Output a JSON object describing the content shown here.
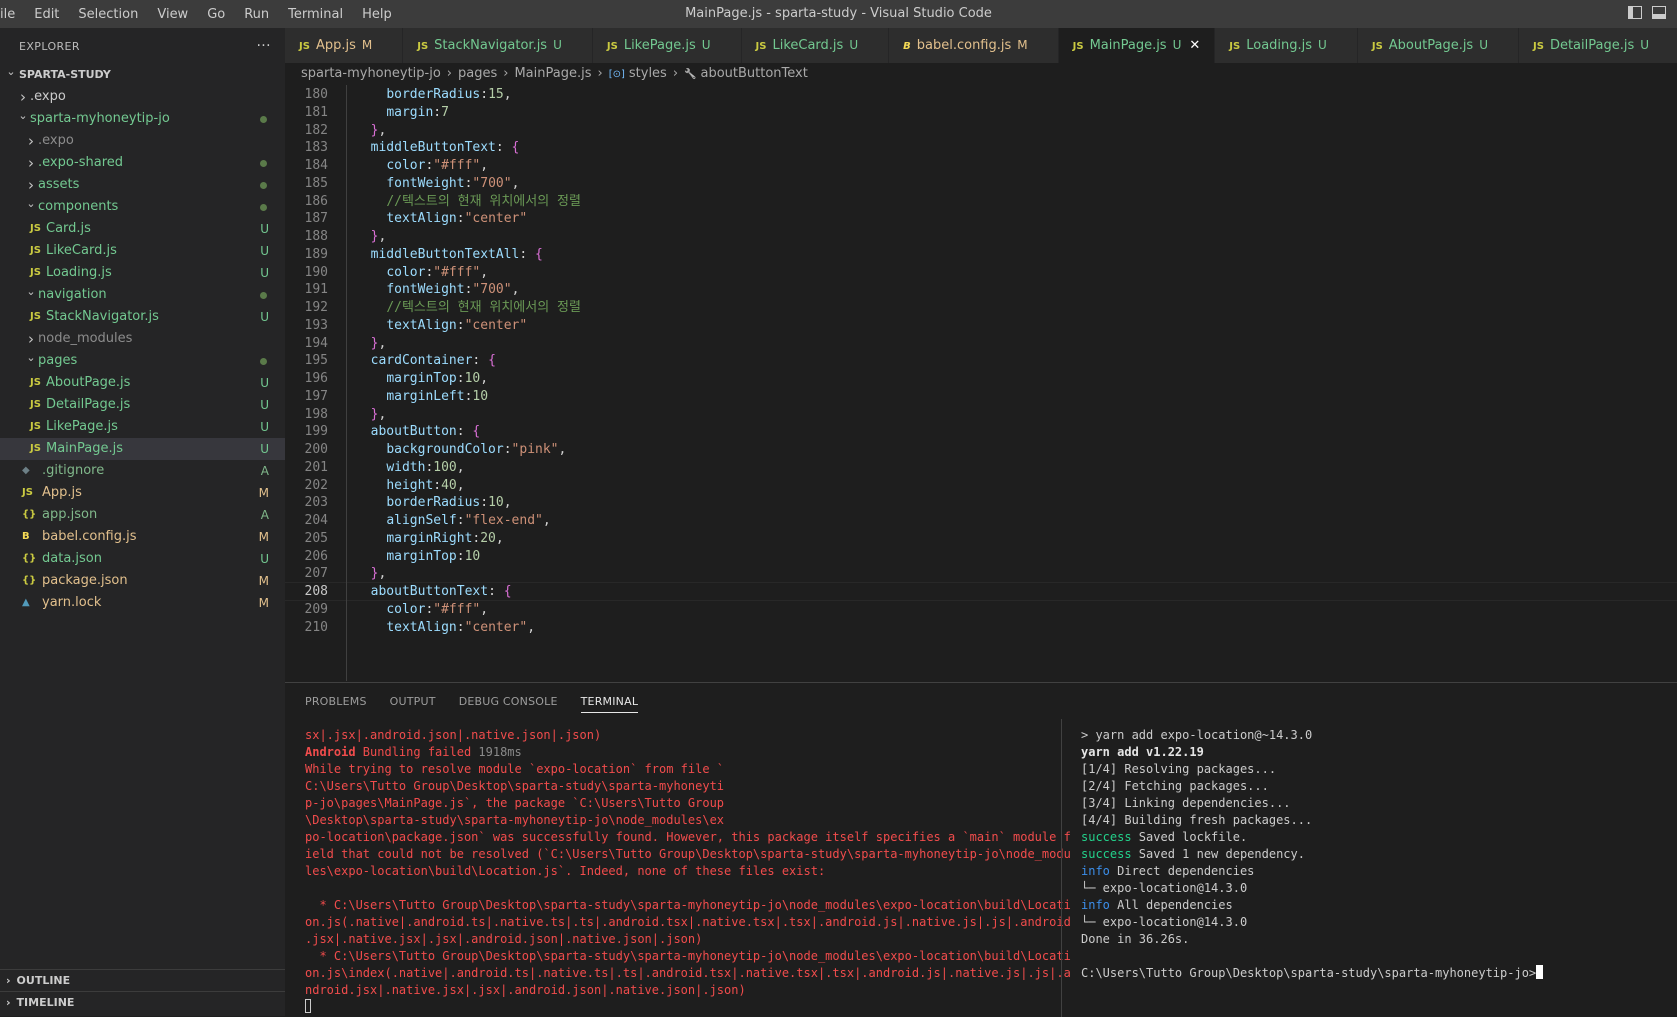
{
  "menu": [
    "ile",
    "Edit",
    "Selection",
    "View",
    "Go",
    "Run",
    "Terminal",
    "Help"
  ],
  "window_title": "MainPage.js - sparta-study - Visual Studio Code",
  "sidebar": {
    "header": "EXPLORER",
    "more": "···",
    "outline": "OUTLINE",
    "timeline": "TIMELINE",
    "tree": [
      {
        "label": "SPARTA-STUDY",
        "depth": 0,
        "kind": "root",
        "open": true
      },
      {
        "label": ".expo",
        "depth": 1,
        "kind": "folder",
        "open": false,
        "color": "#cccccc"
      },
      {
        "label": "sparta-myhoneytip-jo",
        "depth": 1,
        "kind": "folder",
        "open": true,
        "color": "#73c991",
        "dot": true
      },
      {
        "label": ".expo",
        "depth": 2,
        "kind": "folder",
        "open": false,
        "color": "#8c8c8c"
      },
      {
        "label": ".expo-shared",
        "depth": 2,
        "kind": "folder",
        "open": false,
        "color": "#73c991",
        "dot": true
      },
      {
        "label": "assets",
        "depth": 2,
        "kind": "folder",
        "open": false,
        "color": "#73c991",
        "dot": true
      },
      {
        "label": "components",
        "depth": 2,
        "kind": "folder",
        "open": true,
        "color": "#73c991",
        "dot": true
      },
      {
        "label": "Card.js",
        "depth": 3,
        "kind": "js",
        "color": "#73c991",
        "badge": "U"
      },
      {
        "label": "LikeCard.js",
        "depth": 3,
        "kind": "js",
        "color": "#73c991",
        "badge": "U"
      },
      {
        "label": "Loading.js",
        "depth": 3,
        "kind": "js",
        "color": "#73c991",
        "badge": "U"
      },
      {
        "label": "navigation",
        "depth": 2,
        "kind": "folder",
        "open": true,
        "color": "#73c991",
        "dot": true
      },
      {
        "label": "StackNavigator.js",
        "depth": 3,
        "kind": "js",
        "color": "#73c991",
        "badge": "U"
      },
      {
        "label": "node_modules",
        "depth": 2,
        "kind": "folder",
        "open": false,
        "color": "#8c8c8c"
      },
      {
        "label": "pages",
        "depth": 2,
        "kind": "folder",
        "open": true,
        "color": "#73c991",
        "dot": true
      },
      {
        "label": "AboutPage.js",
        "depth": 3,
        "kind": "js",
        "color": "#73c991",
        "badge": "U"
      },
      {
        "label": "DetailPage.js",
        "depth": 3,
        "kind": "js",
        "color": "#73c991",
        "badge": "U"
      },
      {
        "label": "LikePage.js",
        "depth": 3,
        "kind": "js",
        "color": "#73c991",
        "badge": "U"
      },
      {
        "label": "MainPage.js",
        "depth": 3,
        "kind": "js",
        "color": "#73c991",
        "badge": "U",
        "selected": true
      },
      {
        "label": ".gitignore",
        "depth": 2,
        "kind": "git",
        "color": "#81b88b",
        "badge": "A"
      },
      {
        "label": "App.js",
        "depth": 2,
        "kind": "js",
        "color": "#e2c08d",
        "badge": "M"
      },
      {
        "label": "app.json",
        "depth": 2,
        "kind": "json",
        "color": "#81b88b",
        "badge": "A"
      },
      {
        "label": "babel.config.js",
        "depth": 2,
        "kind": "babel",
        "color": "#e2c08d",
        "badge": "M"
      },
      {
        "label": "data.json",
        "depth": 2,
        "kind": "json",
        "color": "#73c991",
        "badge": "U"
      },
      {
        "label": "package.json",
        "depth": 2,
        "kind": "json",
        "color": "#e2c08d",
        "badge": "M"
      },
      {
        "label": "yarn.lock",
        "depth": 2,
        "kind": "yarn",
        "color": "#e2c08d",
        "badge": "M"
      }
    ]
  },
  "tabs": [
    {
      "label": "App.js",
      "status": "M",
      "icon": "JS",
      "color": "#e2c08d"
    },
    {
      "label": "StackNavigator.js",
      "status": "U",
      "icon": "JS",
      "color": "#73c991"
    },
    {
      "label": "LikePage.js",
      "status": "U",
      "icon": "JS",
      "color": "#73c991"
    },
    {
      "label": "LikeCard.js",
      "status": "U",
      "icon": "JS",
      "color": "#73c991"
    },
    {
      "label": "babel.config.js",
      "status": "M",
      "icon": "babel",
      "color": "#e2c08d"
    },
    {
      "label": "MainPage.js",
      "status": "U",
      "icon": "JS",
      "color": "#73c991",
      "active": true
    },
    {
      "label": "Loading.js",
      "status": "U",
      "icon": "JS",
      "color": "#73c991"
    },
    {
      "label": "AboutPage.js",
      "status": "U",
      "icon": "JS",
      "color": "#73c991"
    },
    {
      "label": "DetailPage.js",
      "status": "U",
      "icon": "JS",
      "color": "#73c991"
    },
    {
      "label": "Card.js",
      "status": "U",
      "icon": "JS",
      "color": "#73c991"
    }
  ],
  "breadcrumb": [
    "sparta-myhoneytip-jo",
    "pages",
    "MainPage.js",
    "styles",
    "aboutButtonText"
  ],
  "editor": {
    "current_line": "208",
    "lines": [
      {
        "n": "180",
        "t": "    borderRadius:15,"
      },
      {
        "n": "181",
        "t": "    margin:7"
      },
      {
        "n": "182",
        "t": "  },"
      },
      {
        "n": "183",
        "t": "  middleButtonText: {"
      },
      {
        "n": "184",
        "t": "    color:\"#fff\","
      },
      {
        "n": "185",
        "t": "    fontWeight:\"700\","
      },
      {
        "n": "186",
        "t": "    //텍스트의 현재 위치에서의 정렬"
      },
      {
        "n": "187",
        "t": "    textAlign:\"center\""
      },
      {
        "n": "188",
        "t": "  },"
      },
      {
        "n": "189",
        "t": "  middleButtonTextAll: {"
      },
      {
        "n": "190",
        "t": "    color:\"#fff\","
      },
      {
        "n": "191",
        "t": "    fontWeight:\"700\","
      },
      {
        "n": "192",
        "t": "    //텍스트의 현재 위치에서의 정렬"
      },
      {
        "n": "193",
        "t": "    textAlign:\"center\""
      },
      {
        "n": "194",
        "t": "  },"
      },
      {
        "n": "195",
        "t": "  cardContainer: {"
      },
      {
        "n": "196",
        "t": "    marginTop:10,"
      },
      {
        "n": "197",
        "t": "    marginLeft:10"
      },
      {
        "n": "198",
        "t": "  },"
      },
      {
        "n": "199",
        "t": "  aboutButton: {"
      },
      {
        "n": "200",
        "t": "    backgroundColor:\"pink\","
      },
      {
        "n": "201",
        "t": "    width:100,"
      },
      {
        "n": "202",
        "t": "    height:40,"
      },
      {
        "n": "203",
        "t": "    borderRadius:10,"
      },
      {
        "n": "204",
        "t": "    alignSelf:\"flex-end\","
      },
      {
        "n": "205",
        "t": "    marginRight:20,"
      },
      {
        "n": "206",
        "t": "    marginTop:10"
      },
      {
        "n": "207",
        "t": "  },"
      },
      {
        "n": "208",
        "t": "  aboutButtonText: {"
      },
      {
        "n": "209",
        "t": "    color:\"#fff\","
      },
      {
        "n": "210",
        "t": "    textAlign:\"center\","
      }
    ]
  },
  "panel": {
    "tabs": [
      "PROBLEMS",
      "OUTPUT",
      "DEBUG CONSOLE",
      "TERMINAL"
    ],
    "active_tab": "TERMINAL",
    "terminal_left": [
      "sx|.jsx|.android.json|.native.json|.json)",
      "__ANDROID__",
      "While trying to resolve module `expo-location` from file `",
      "C:\\Users\\Tutto Group\\Desktop\\sparta-study\\sparta-myhoneyti",
      "p-jo\\pages\\MainPage.js`, the package `C:\\Users\\Tutto Group",
      "\\Desktop\\sparta-study\\sparta-myhoneytip-jo\\node_modules\\ex",
      "po-location\\package.json` was successfully found. However, this package itself specifies a `main` module f",
      "ield that could not be resolved (`C:\\Users\\Tutto Group\\Desktop\\sparta-study\\sparta-myhoneytip-jo\\node_modu",
      "les\\expo-location\\build\\Location.js`. Indeed, none of these files exist:",
      "",
      "  * C:\\Users\\Tutto Group\\Desktop\\sparta-study\\sparta-myhoneytip-jo\\node_modules\\expo-location\\build\\Locati",
      "on.js(.native|.android.ts|.native.ts|.ts|.android.tsx|.native.tsx|.tsx|.android.js|.native.js|.js|.android",
      ".jsx|.native.jsx|.jsx|.android.json|.native.json|.json)",
      "  * C:\\Users\\Tutto Group\\Desktop\\sparta-study\\sparta-myhoneytip-jo\\node_modules\\expo-location\\build\\Locati",
      "on.js\\index(.native|.android.ts|.native.ts|.ts|.android.tsx|.native.tsx|.tsx|.android.js|.native.js|.js|.a",
      "ndroid.jsx|.native.jsx|.jsx|.android.json|.native.json|.json)"
    ],
    "android_bold": "Android",
    "android_rest": " Bundling failed ",
    "android_time": "1918ms",
    "terminal_right": {
      "cmd": "> yarn add expo-location@~14.3.0",
      "yarn_version": "yarn add v1.22.19",
      "steps": [
        "[1/4] Resolving packages...",
        "[2/4] Fetching packages...",
        "[3/4] Linking dependencies...",
        "[4/4] Building fresh packages..."
      ],
      "success1_tag": "success",
      "success1": " Saved lockfile.",
      "success2_tag": "success",
      "success2": " Saved 1 new dependency.",
      "info1_tag": "info",
      "info1": " Direct dependencies",
      "dep1": "└─ expo-location@14.3.0",
      "info2_tag": "info",
      "info2": " All dependencies",
      "dep2": "└─ expo-location@14.3.0",
      "done": "Done in 36.26s.",
      "prompt": "C:\\Users\\Tutto Group\\Desktop\\sparta-study\\sparta-myhoneytip-jo>"
    }
  }
}
